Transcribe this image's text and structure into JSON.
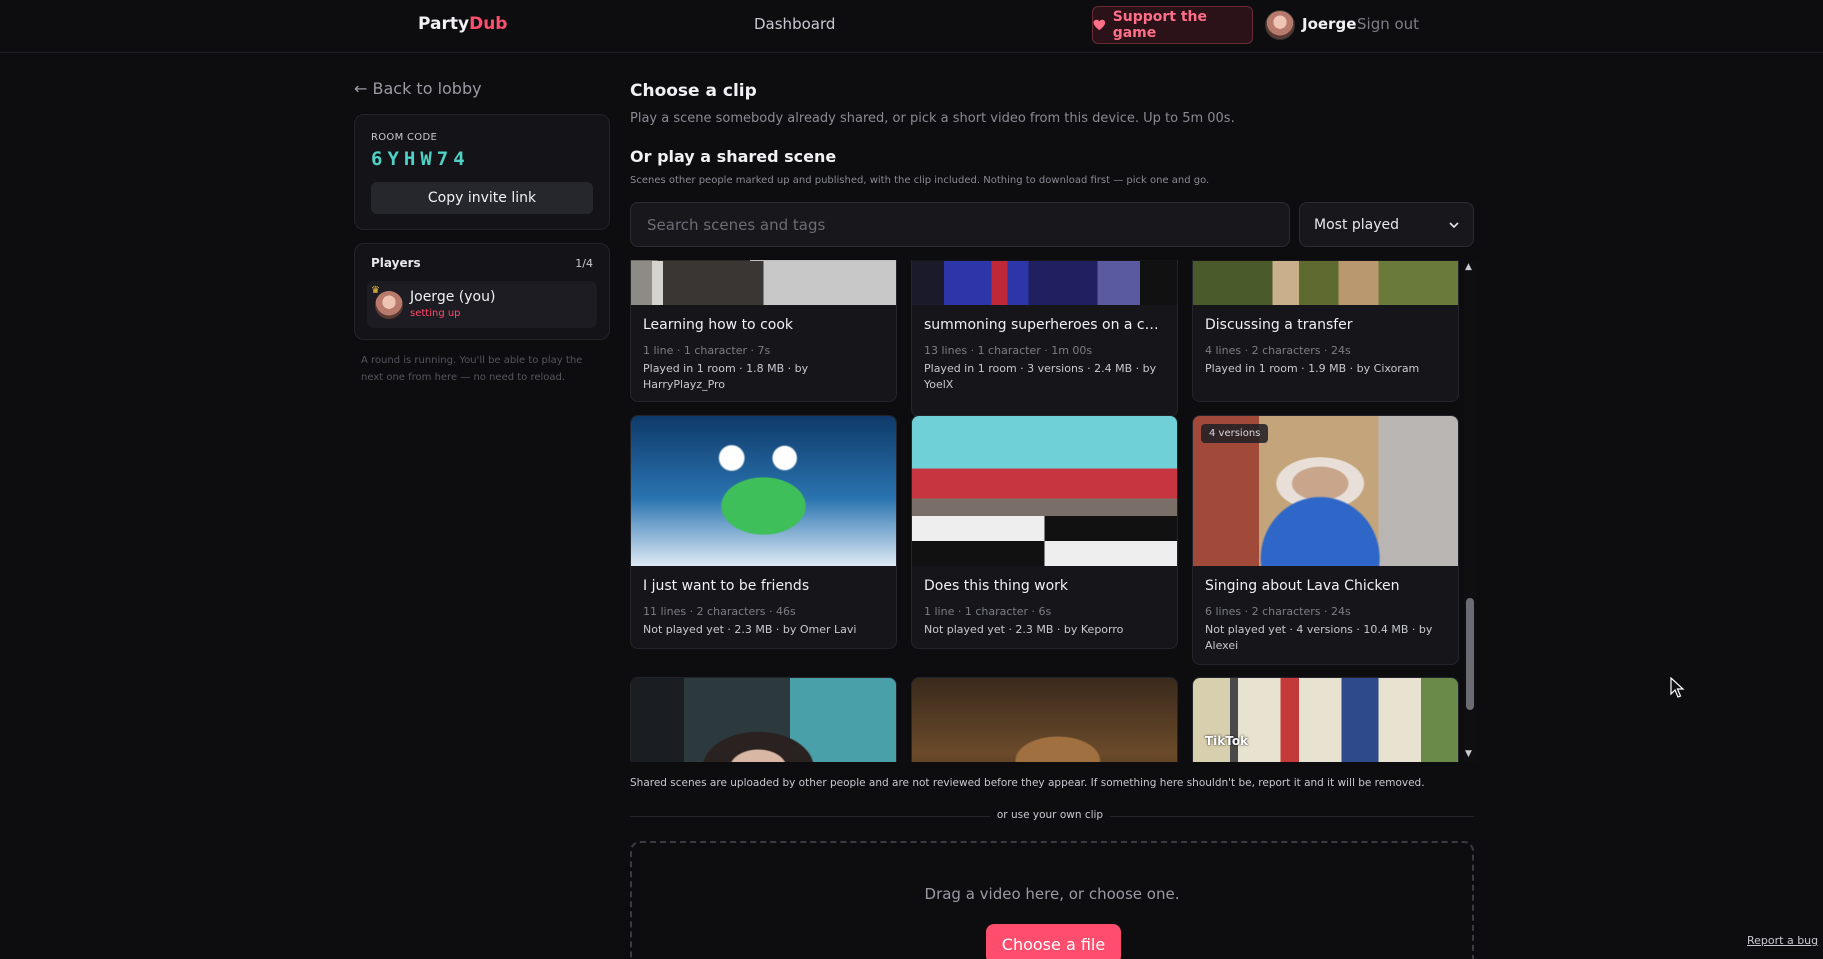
{
  "header": {
    "brand_part1": "Party",
    "brand_part2": "Dub",
    "nav_dashboard": "Dashboard",
    "support_label": "Support the game",
    "username": "Joerge",
    "signout_label": "Sign out"
  },
  "sidebar": {
    "back_label": "← Back to lobby",
    "room_code_label": "ROOM CODE",
    "room_code": "6YHW74",
    "copy_invite_label": "Copy invite link",
    "players_title": "Players",
    "players_count": "1/4",
    "player_name": "Joerge (you)",
    "player_status": "setting up",
    "round_note": "A round is running. You'll be able to play the next one from here — no need to reload."
  },
  "main": {
    "title": "Choose a clip",
    "subtitle": "Play a scene somebody already shared, or pick a short video from this device. Up to 5m 00s.",
    "shared_title": "Or play a shared scene",
    "shared_subtitle": "Scenes other people marked up and published, with the clip included. Nothing to download first — pick one and go.",
    "search_placeholder": "Search scenes and tags",
    "sort_selected": "Most played",
    "cards": [
      {
        "title": "Learning how to cook",
        "meta": "1 line · 1 character · 7s",
        "stats": "Played in 1 room · 1.8 MB · by HarryPlayz_Pro"
      },
      {
        "title": "summoning superheroes on a comp...",
        "meta": "13 lines · 1 character · 1m 00s",
        "stats": "Played in 1 room · 3 versions · 2.4 MB · by YoelX"
      },
      {
        "title": "Discussing a transfer",
        "meta": "4 lines · 2 characters · 24s",
        "stats": "Played in 1 room · 1.9 MB · by Cixoram"
      },
      {
        "title": "I just want to be friends",
        "meta": "11 lines · 2 characters · 46s",
        "stats": "Not played yet · 2.3 MB · by Omer Lavi"
      },
      {
        "title": "Does this thing work",
        "meta": "1 line · 1 character · 6s",
        "stats": "Not played yet · 2.3 MB · by Keporro"
      },
      {
        "title": "Singing about Lava Chicken",
        "meta": "6 lines · 2 characters · 24s",
        "stats": "Not played yet · 4 versions · 10.4 MB · by Alexei",
        "badge": "4 versions"
      }
    ],
    "tiktok_watermark": "TikTok",
    "disclaimer": "Shared scenes are uploaded by other people and are not reviewed before they appear. If something here shouldn't be, report it and it will be removed.",
    "divider_label": "or use your own clip",
    "drop_text": "Drag a video here, or choose one.",
    "choose_file_label": "Choose a file"
  },
  "footer": {
    "report_bug": "Report a bug"
  },
  "colors": {
    "accent": "#ff4d6d",
    "room_code": "#4fd1c5",
    "background": "#0d0d10"
  }
}
